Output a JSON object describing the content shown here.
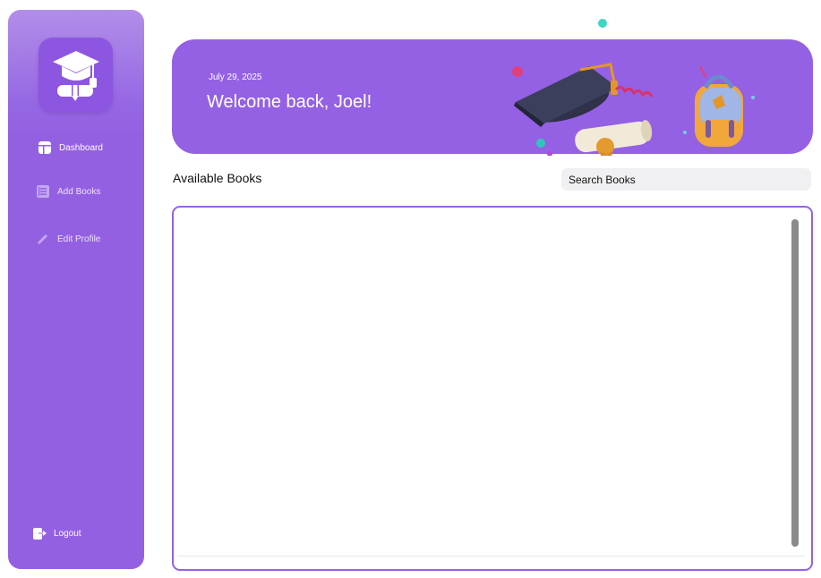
{
  "sidebar": {
    "logo_icon": "graduation-cap-diploma-icon",
    "items": [
      {
        "label": "Dashboard",
        "icon": "dashboard-icon"
      },
      {
        "label": "Add Books",
        "icon": "book-list-icon"
      },
      {
        "label": "Edit Profile",
        "icon": "pencil-icon"
      }
    ],
    "logout": {
      "label": "Logout",
      "icon": "logout-icon"
    }
  },
  "banner": {
    "date": "July 29, 2025",
    "greeting": "Welcome back, Joel!",
    "art": "graduation-cap-diploma-backpack-illustration"
  },
  "books": {
    "section_title": "Available Books",
    "search_placeholder": "Search Books"
  },
  "colors": {
    "accent": "#9461e4",
    "sidebar": "#9460e2",
    "scrollbar": "#8a8a8a"
  }
}
